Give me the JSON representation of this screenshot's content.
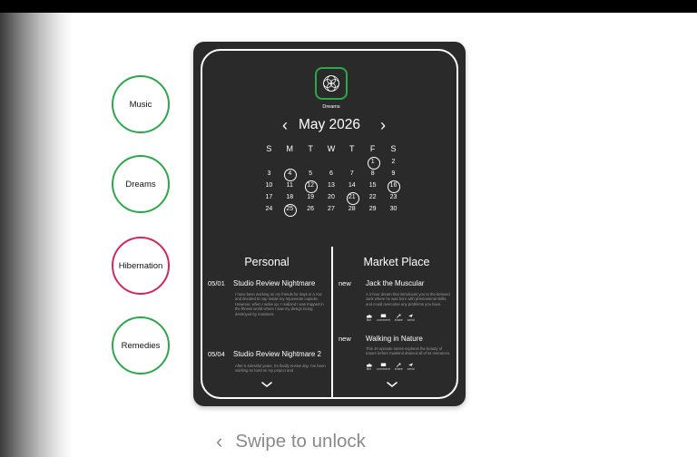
{
  "side_buttons": [
    {
      "label": "Music",
      "color": "#2aa84a"
    },
    {
      "label": "Dreams",
      "color": "#2aa84a"
    },
    {
      "label": "Hibernation",
      "color": "#d8245c"
    },
    {
      "label": "Remedies",
      "color": "#2aa84a"
    }
  ],
  "app": {
    "name": "Dreams",
    "accent": "#2aa84a"
  },
  "calendar": {
    "month_label": "May 2026",
    "prev_icon": "chevron-left-icon",
    "next_icon": "chevron-right-icon",
    "weekdays": [
      "S",
      "M",
      "T",
      "W",
      "T",
      "F",
      "S"
    ],
    "weeks": [
      [
        "",
        "",
        "",
        "",
        "",
        "1",
        "2"
      ],
      [
        "3",
        "4",
        "5",
        "6",
        "7",
        "8",
        "9"
      ],
      [
        "10",
        "11",
        "12",
        "13",
        "14",
        "15",
        "16"
      ],
      [
        "17",
        "18",
        "19",
        "20",
        "21",
        "22",
        "23"
      ],
      [
        "24",
        "25",
        "26",
        "27",
        "28",
        "29",
        "30"
      ]
    ],
    "circled": [
      "1",
      "4",
      "12",
      "16",
      "21",
      "25"
    ]
  },
  "personal": {
    "title": "Personal",
    "entries": [
      {
        "date": "05/01",
        "title": "Studio Review Nightmare",
        "body": "I have been working on my friends for days in a row and decided to nap inside my rejuvenate capsule. However, when I woke up, I realized I was trapped in the fitness world where I saw my design being destroyed by monsters."
      },
      {
        "date": "05/04",
        "title": "Studio Review Nightmare 2",
        "body": "After 5 stressful years, it's finally review day. I've been working so hard on my project and"
      }
    ]
  },
  "market": {
    "title": "Market Place",
    "entries": [
      {
        "tag": "new",
        "title": "Jack the Muscular",
        "body": "A 3 hour dream that introduces you to the beloved Jack where he was born with phenomenal skills, and could overcome any problems you have."
      },
      {
        "tag": "new",
        "title": "Walking in Nature",
        "body": "This 10 episode series explores the beauty of nature before mankind drained all of its resources."
      }
    ],
    "actions": [
      "like",
      "comment",
      "share",
      "send"
    ]
  },
  "swipe": {
    "label": "Swipe to unlock"
  }
}
